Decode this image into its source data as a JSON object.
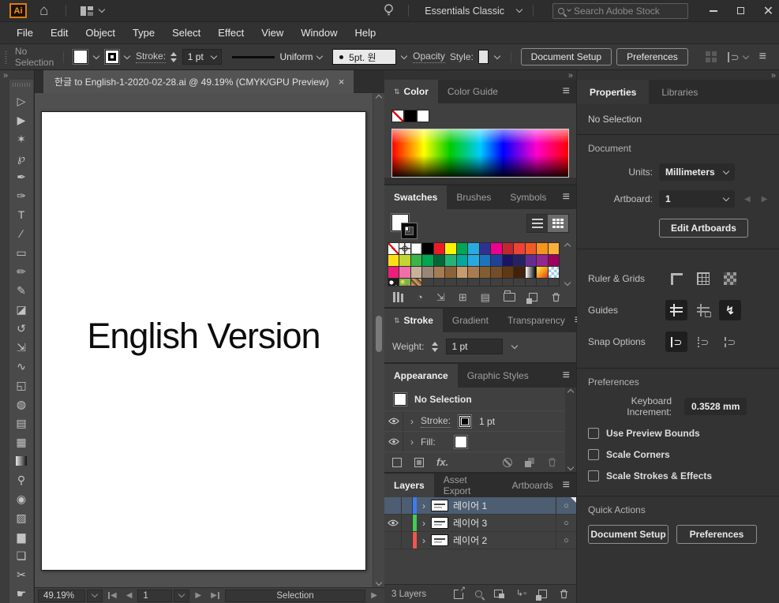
{
  "titlebar": {
    "app_logo": "Ai",
    "workspace": "Essentials Classic",
    "search_placeholder": "Search Adobe Stock"
  },
  "menus": [
    "File",
    "Edit",
    "Object",
    "Type",
    "Select",
    "Effect",
    "View",
    "Window",
    "Help"
  ],
  "control_bar": {
    "selection_status": "No Selection",
    "stroke_label": "Stroke:",
    "stroke_value": "1 pt",
    "variable_width_profile": "Uniform",
    "brush_definition": "5pt. 원",
    "opacity_label": "Opacity",
    "style_label": "Style:",
    "document_setup_label": "Document Setup",
    "preferences_label": "Preferences"
  },
  "document_tab": {
    "title": "한글 to English-1-2020-02-28.ai @ 49.19% (CMYK/GPU Preview)",
    "close_glyph": "×"
  },
  "artboard": {
    "text": "English Version"
  },
  "tools": [
    {
      "name": "selection",
      "glyph": "▷"
    },
    {
      "name": "direct-selection",
      "glyph": "▶"
    },
    {
      "name": "magic-wand",
      "glyph": "✶"
    },
    {
      "name": "lasso",
      "glyph": "℘"
    },
    {
      "name": "pen",
      "glyph": "✒"
    },
    {
      "name": "curvature",
      "glyph": "✑"
    },
    {
      "name": "type",
      "glyph": "T"
    },
    {
      "name": "line-segment",
      "glyph": "∕"
    },
    {
      "name": "rectangle",
      "glyph": "▭"
    },
    {
      "name": "paintbrush",
      "glyph": "✏"
    },
    {
      "name": "shaper",
      "glyph": "✎"
    },
    {
      "name": "eraser",
      "glyph": "◪"
    },
    {
      "name": "rotate",
      "glyph": "↺"
    },
    {
      "name": "scale",
      "glyph": "⇲"
    },
    {
      "name": "width",
      "glyph": "∿"
    },
    {
      "name": "free-transform",
      "glyph": "◱"
    },
    {
      "name": "shape-builder",
      "glyph": "◍"
    },
    {
      "name": "perspective-grid",
      "glyph": "▤"
    },
    {
      "name": "mesh",
      "glyph": "▦"
    },
    {
      "name": "gradient",
      "glyph": ""
    },
    {
      "name": "eyedropper",
      "glyph": "⚲"
    },
    {
      "name": "blend",
      "glyph": "◉"
    },
    {
      "name": "symbol-sprayer",
      "glyph": "▨"
    },
    {
      "name": "column-graph",
      "glyph": "▆"
    },
    {
      "name": "artboard",
      "glyph": "❏"
    },
    {
      "name": "slice",
      "glyph": "✂"
    },
    {
      "name": "hand",
      "glyph": "☛"
    }
  ],
  "status_bar": {
    "zoom_level": "49.19%",
    "artboard_number": "1",
    "tool_name": "Selection"
  },
  "panels": {
    "color": {
      "tabs": [
        "Color",
        "Color Guide"
      ]
    },
    "swatches": {
      "tabs": [
        "Swatches",
        "Brushes",
        "Symbols"
      ],
      "grid": [
        "none",
        "registration",
        "white",
        "#000000",
        "#ED1C24",
        "#FFF200",
        "#00A651",
        "#29ABE2",
        "#2E3192",
        "#EC008C",
        "#C1272D",
        "#EF4136",
        "#F15A24",
        "#F7941D",
        "#FBB03B",
        "#FFDE17",
        "#BFD730",
        "#39B54A",
        "#00A651",
        "#006838",
        "#22B573",
        "#00A99D",
        "#27AAE1",
        "#1C75BC",
        "#21409A",
        "#1B1464",
        "#262262",
        "#662D91",
        "#92278F",
        "#9E005D",
        "#ED1E79",
        "#F06EAA",
        "#C7B299",
        "#998675",
        "#A67C52",
        "#8C6239",
        "#C69C6D",
        "#A97C50",
        "#825D33",
        "#754C29",
        "#603913",
        "#42210B",
        "gradient-bw",
        "gradient-fire",
        "transparency",
        "pattern-dots",
        "pattern-flowers",
        "pattern-texture",
        "empty",
        "empty",
        "empty",
        "empty",
        "empty",
        "empty",
        "empty",
        "empty",
        "empty",
        "empty",
        "empty",
        "empty"
      ]
    },
    "stroke": {
      "tabs": [
        "Stroke",
        "Gradient",
        "Transparency"
      ],
      "weight_label": "Weight:",
      "weight_value": "1 pt"
    },
    "appearance": {
      "tabs": [
        "Appearance",
        "Graphic Styles"
      ],
      "no_selection": "No Selection",
      "stroke_label": "Stroke:",
      "stroke_value": "1 pt",
      "fill_label": "Fill:",
      "fx_label": "fx."
    },
    "layers": {
      "tabs": [
        "Layers",
        "Asset Export",
        "Artboards"
      ],
      "rows": [
        {
          "name": "레이어 1",
          "color": "#3E7BF2",
          "visible": false,
          "selected": true
        },
        {
          "name": "레이어 3",
          "color": "#41CD52",
          "visible": true,
          "selected": false
        },
        {
          "name": "레이어 2",
          "color": "#F2544F",
          "visible": false,
          "selected": false
        }
      ],
      "count_label": "3 Layers"
    },
    "properties": {
      "tabs": [
        "Properties",
        "Libraries"
      ],
      "selection_status": "No Selection",
      "document_section": "Document",
      "units_label": "Units:",
      "units_value": "Millimeters",
      "artboard_label": "Artboard:",
      "artboard_value": "1",
      "edit_artboards_label": "Edit Artboards",
      "ruler_grids_label": "Ruler & Grids",
      "guides_label": "Guides",
      "snap_options_label": "Snap Options",
      "preferences_section": "Preferences",
      "keyboard_increment_label": "Keyboard Increment:",
      "keyboard_increment_value": "0.3528 mm",
      "checkbox_labels": [
        "Use Preview Bounds",
        "Scale Corners",
        "Scale Strokes & Effects"
      ],
      "quick_actions_section": "Quick Actions",
      "quick_document_setup": "Document Setup",
      "quick_preferences": "Preferences"
    }
  }
}
